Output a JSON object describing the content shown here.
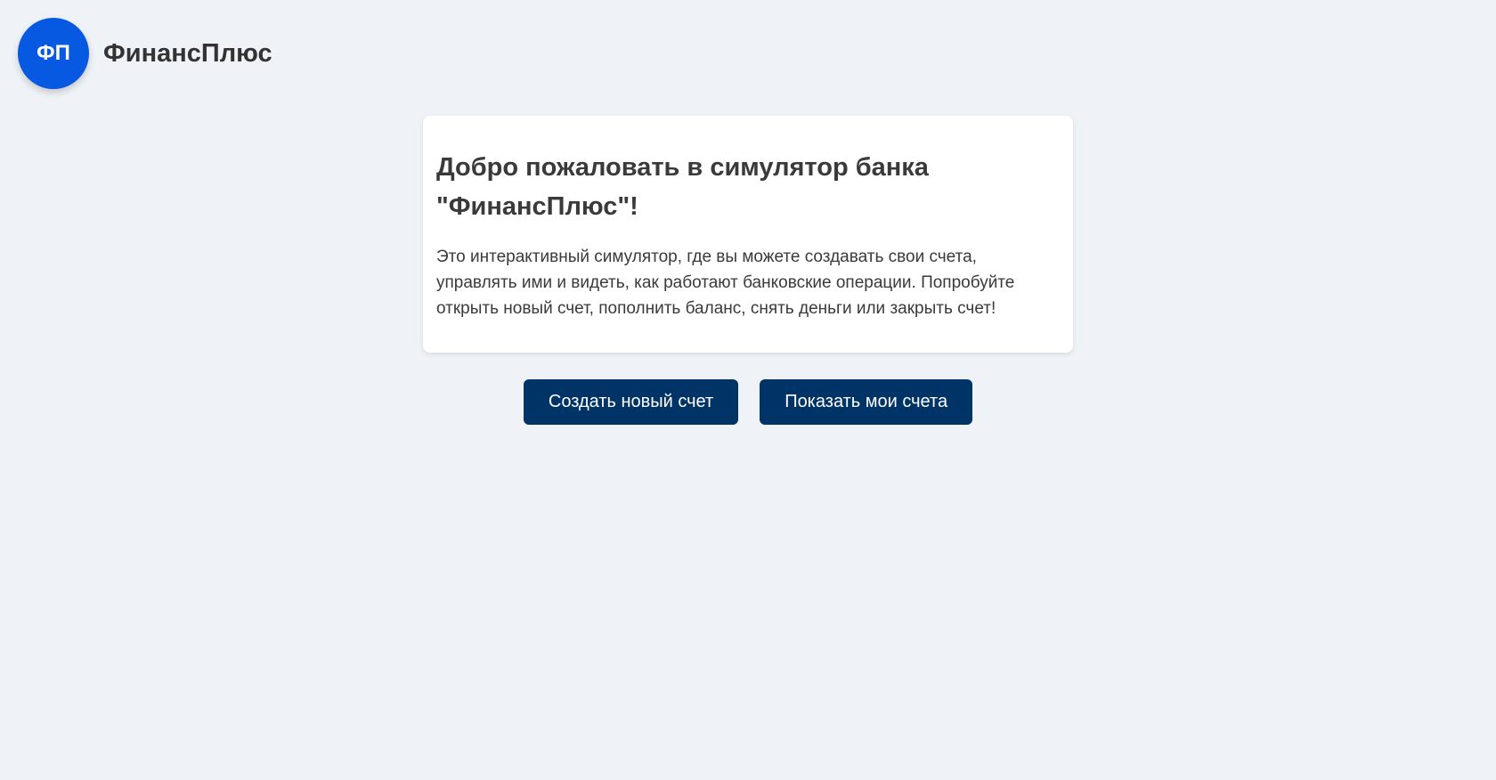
{
  "header": {
    "logo_text": "ФП",
    "brand": "ФинансПлюс"
  },
  "welcome": {
    "title": "Добро пожаловать в симулятор банка \"ФинансПлюс\"!",
    "text": "Это интерактивный симулятор, где вы можете создавать свои счета, управлять ими и видеть, как работают банковские операции. Попробуйте открыть новый счет, пополнить баланс, снять деньги или закрыть счет!"
  },
  "actions": {
    "create_label": "Создать новый счет",
    "show_label": "Показать мои счета"
  },
  "colors": {
    "background": "#eff3f8",
    "logo": "#0659e0",
    "button": "#003366"
  }
}
